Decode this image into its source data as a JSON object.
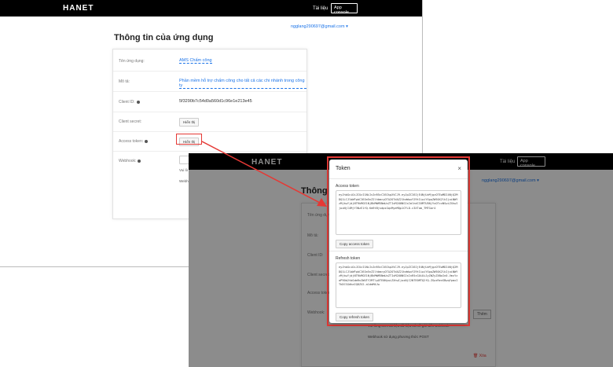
{
  "app": {
    "brand": "HANET"
  },
  "nav": {
    "docs_label": "Tài liệu",
    "console_label": "App console"
  },
  "user": {
    "email": "ngglang290697@gmail.com"
  },
  "page": {
    "title": "Thông tin của ứng dụng"
  },
  "fields": [
    {
      "label": "Tên ứng dụng:",
      "value": "AMS Chấm công"
    },
    {
      "label": "Mô tả:",
      "value": "Phần mềm hỗ trợ chấm công cho tất cả các chi nhánh trong công ty"
    },
    {
      "label": "Client ID:",
      "value": "5f3290b7c54d0a560d1c96e1e213e45"
    },
    {
      "label": "Client secret:",
      "value": "Hiển thị"
    },
    {
      "label": "Access token:",
      "value": "Hiển thị"
    },
    {
      "label": "Webhook:",
      "value": ""
    }
  ],
  "back_extra": {
    "webhook_note": "Vui lò",
    "webhook_note2": "Webho"
  },
  "front": {
    "title": "Thông ti",
    "webhook_note1": "Vui lòng xem tài liệu dữ liệu trả về gửi đến webhook",
    "webhook_note2": "Webhook sử dụng phương thức POST",
    "side_button": "Thêm",
    "delete_label": "Xóa"
  },
  "modal": {
    "title": "Token",
    "close": "×",
    "access_label": "Access token",
    "access_token": "eyJhbGciOiJIUzI1NiIsInR5cCI6IkpXVCJ9.eyJpZCI6IjE4NjUzMjgzOTEwMDI4NjQ2MDQ1LCJlbWFpbCI6Im5nZ2lhbmcyOTA2OTdAZ21haWwuY29tIiwiYXpwZW50X2lkIjoiNWYzMjkwYjdjNTRkMGE1NjBkMWM5NmUxZTIxM2U0NSIsImlhdCI6MTU5NjYxOTcxNSwiZXhwIjoxNjI4MjY3NzE1fQ.Km9tBjsdpsGqvMyeMQp1CFLD-c3XTam_TMTGar4",
    "copy_access": "Copy access token",
    "refresh_label": "Refresh token",
    "refresh_token": "eyJhbGciOiJIUzI1NiIsInR5cCI6IkpXVCJ9.eyJpZCI6IjE4NjUzMjgzOTEwMDI4NjQ2MDQ1LCJlbWFpbCI6Im5nZ2lhbmcyOTA2OTdAZ21haWwuY29tIiwiYXpwZW50X2lkIjoiNWYzMjkwYjdjNTRkMGE1NjBkMWM5NmUxZTIxM2U0NSIsInR5cGUiOiJyZWZyZXNoIn0.VmxYzaP90b2tbGdmRnZWUTY2MTlpOTE0NywiZXhwIjoxNjI2NTE0MTQ2fQ.ZGwzRenSBwqYpmxITkDCSGdhaIQ8ZX2-a1dmM4Jw",
    "copy_refresh": "Copy refresh token"
  },
  "colors": {
    "accent": "#1a73e8",
    "highlight": "#e53935",
    "topbar": "#000000"
  }
}
